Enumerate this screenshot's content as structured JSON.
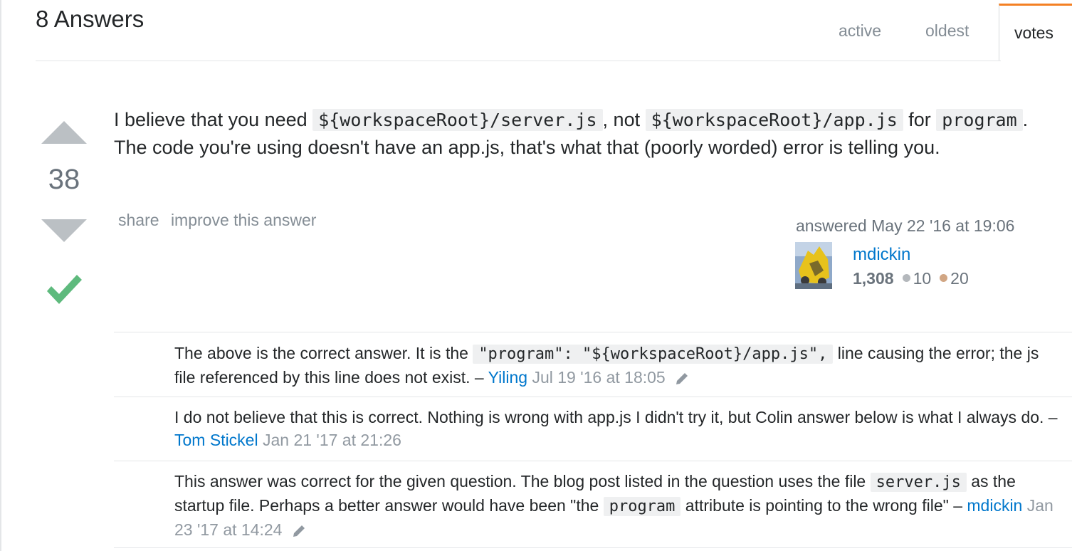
{
  "header": {
    "title": "8 Answers",
    "tabs": {
      "active": "active",
      "oldest": "oldest",
      "votes": "votes"
    },
    "accent_color": "#f48024"
  },
  "answer": {
    "vote_count": "38",
    "accepted": true,
    "accepted_color": "#5eba7d",
    "body": {
      "t1": "I believe that you need ",
      "c1": "${workspaceRoot}/server.js",
      "t2": ", not ",
      "c2": "${workspaceRoot}/app.js",
      "t3": " for ",
      "c3": "program",
      "t4": ". The code you're using doesn't have an app.js, that's what that (poorly worded) error is telling you."
    },
    "menu": {
      "share": "share",
      "improve": "improve this answer"
    },
    "signature": {
      "action": "answered",
      "time": "May 22 '16 at 19:06",
      "user": "mdickin",
      "reputation": "1,308",
      "silver": "10",
      "bronze": "20"
    }
  },
  "comments": [
    {
      "t1": "The above is the correct answer. It is the ",
      "c1": "\"program\": \"${workspaceRoot}/app.js\",",
      "t2": " line causing the error; the js file referenced by this line does not exist.",
      "sep": " – ",
      "user": "Yiling",
      "date": "Jul 19 '16 at 18:05",
      "edited": true
    },
    {
      "t1": "I do not believe that this is correct. Nothing is wrong with app.js I didn't try it, but Colin answer below is what I always do.",
      "sep": " – ",
      "user": "Tom Stickel",
      "date": "Jan 21 '17 at 21:26",
      "edited": false
    },
    {
      "t1": "This answer was correct for the given question. The blog post listed in the question uses the file ",
      "c1": "server.js",
      "t2": " as the startup file. Perhaps a better answer would have been \"the ",
      "c2": "program",
      "t3": " attribute is pointing to the wrong file\"",
      "sep": " – ",
      "user": "mdickin",
      "date": "Jan 23 '17 at 14:24",
      "edited": true
    }
  ]
}
